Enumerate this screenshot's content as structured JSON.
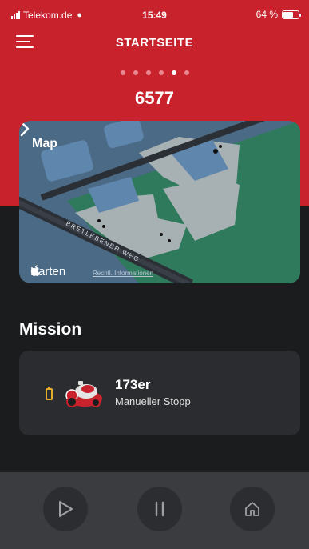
{
  "status_bar": {
    "carrier": "Telekom.de",
    "time": "15:49",
    "battery": "64 %"
  },
  "header": {
    "title": "STARTSEITE",
    "pages": 6,
    "active_page": 4
  },
  "counter": "6577",
  "map": {
    "title": "Map",
    "road": "BRETLEBENER WEG",
    "attribution": "Karten",
    "legal": "Rechtl. Informationen"
  },
  "mission": {
    "heading": "Mission",
    "robot_name": "173er",
    "status": "Manueller Stopp"
  },
  "controls": {
    "play": "play-icon",
    "pause": "pause-icon",
    "home": "home-icon"
  },
  "colors": {
    "brand": "#c8232c",
    "background": "#1b1c1e",
    "card": "#2b2c2f",
    "battery": "#e6ad2b"
  }
}
